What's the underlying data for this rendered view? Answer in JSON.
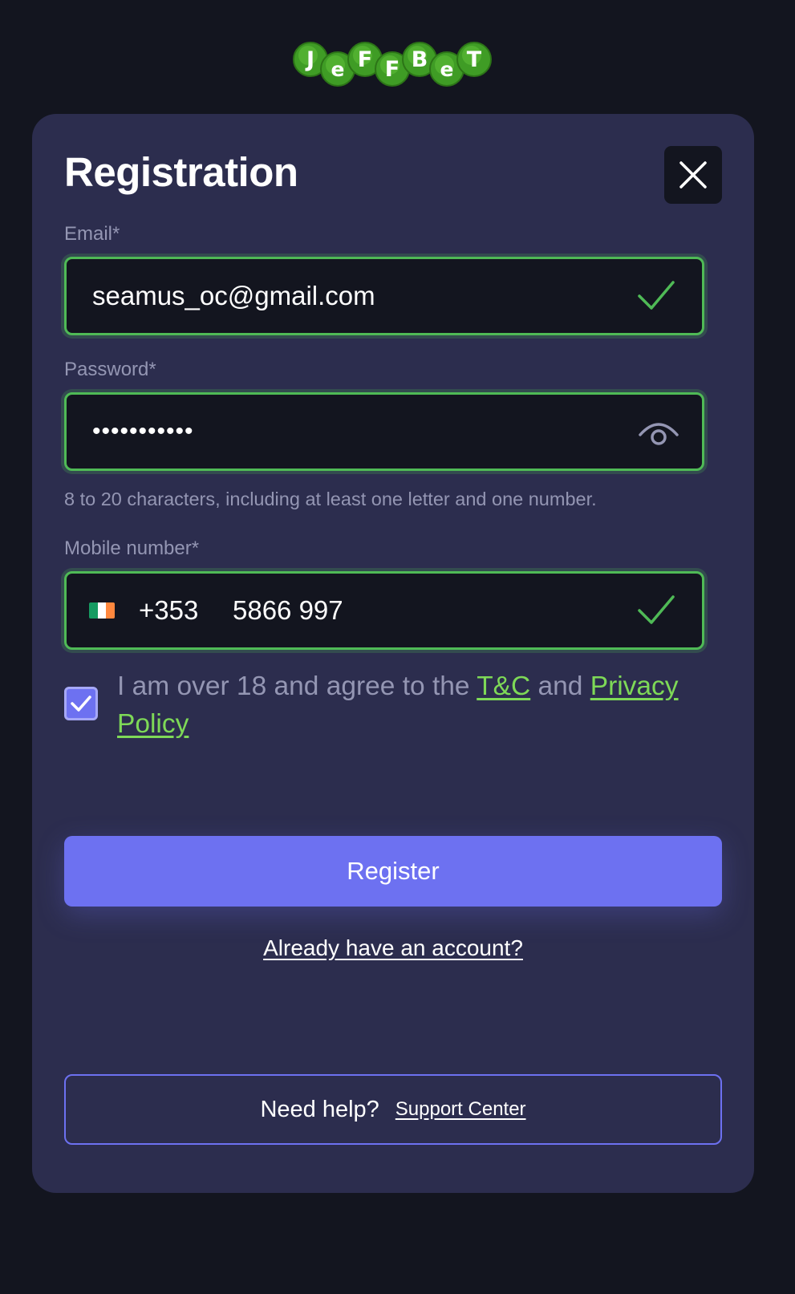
{
  "logo": {
    "letters": [
      "J",
      "e",
      "F",
      "F",
      "B",
      "e",
      "T"
    ],
    "color": "#4fb52f"
  },
  "registration": {
    "title": "Registration",
    "close_icon": "close-icon"
  },
  "email": {
    "label": "Email*",
    "value": "seamus_oc@gmail.com",
    "status_icon": "check-icon"
  },
  "password": {
    "label": "Password*",
    "masked_value": "•••••••••••",
    "toggle_icon": "eye-icon",
    "hint": "8 to 20 characters, including at least one letter and one number."
  },
  "mobile": {
    "label": "Mobile number*",
    "flag_icon": "ireland-flag-icon",
    "dial_code": "+353",
    "number": "5866 997",
    "status_icon": "check-icon"
  },
  "consent": {
    "checked": true,
    "text_before": "I am over 18 and agree to the ",
    "terms_link": "T&C",
    "text_middle": " and ",
    "privacy_link": "Privacy Policy"
  },
  "actions": {
    "register_label": "Register",
    "login_link": "Already have an account?"
  },
  "help": {
    "text": "Need help?",
    "support_link": "Support Center"
  },
  "colors": {
    "background": "#13151f",
    "card": "#2c2d4e",
    "accent": "#6d71f1",
    "success": "#4fba56",
    "link": "#7ed957",
    "muted_text": "#9496b3"
  }
}
